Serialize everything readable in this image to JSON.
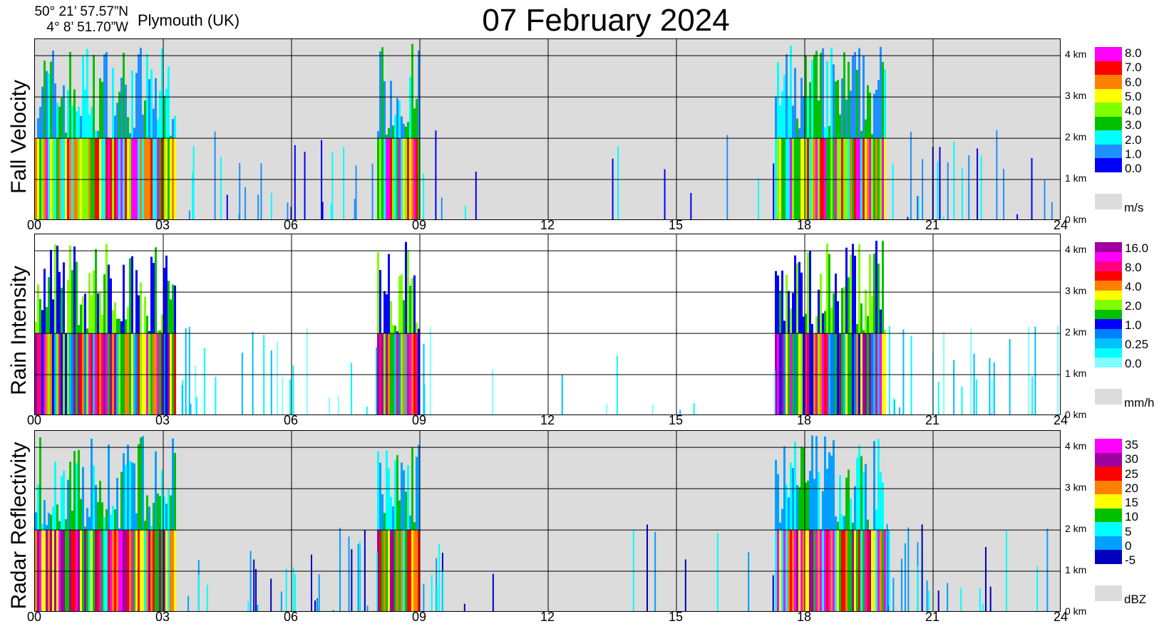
{
  "header": {
    "lat": "50° 21’ 57.57”N",
    "lon": "4°  8’ 51.70”W",
    "location": "Plymouth (UK)",
    "title": "07 February  2024"
  },
  "x_ticks": [
    "00",
    "03",
    "06",
    "09",
    "12",
    "15",
    "18",
    "21",
    "24"
  ],
  "height_ticks": [
    "4 km",
    "3 km",
    "2 km",
    "1 km",
    "0 km"
  ],
  "chart_data": [
    {
      "type": "heatmap",
      "title": "Fall Velocity",
      "x_range_hours": [
        0,
        24
      ],
      "y_range_km": [
        0,
        4.4
      ],
      "grid": true,
      "colorbar": {
        "unit": "m/s",
        "labels": [
          "8.0",
          "7.0",
          "6.0",
          "5.0",
          "4.0",
          "3.0",
          "2.0",
          "1.0",
          "0.0"
        ],
        "colors": [
          "#ff00ff",
          "#ff0000",
          "#ff8000",
          "#ffff00",
          "#80ff00",
          "#00c000",
          "#00ffff",
          "#1e90ff",
          "#0000ff"
        ]
      },
      "precip_periods_hours": [
        [
          0.0,
          3.3
        ],
        [
          8.0,
          9.0
        ],
        [
          17.3,
          19.9
        ]
      ],
      "background_color": "#dcdcdc"
    },
    {
      "type": "heatmap",
      "title": "Rain Intensity",
      "x_range_hours": [
        0,
        24
      ],
      "y_range_km": [
        0,
        4.4
      ],
      "grid": true,
      "colorbar": {
        "unit": "mm/h",
        "labels": [
          "16.0",
          "8.0",
          "4.0",
          "2.0",
          "1.0",
          "0.25",
          "0.0"
        ],
        "colors": [
          "#a000a0",
          "#ff00ff",
          "#ff0080",
          "#ff0000",
          "#ff8000",
          "#ffff00",
          "#80ff00",
          "#00c000",
          "#0000ff",
          "#0080ff",
          "#00c0ff",
          "#00ffff",
          "#80ffff"
        ]
      },
      "precip_periods_hours": [
        [
          0.0,
          3.3
        ],
        [
          8.0,
          9.0
        ],
        [
          17.3,
          19.9
        ]
      ],
      "background_color": "#ffffff"
    },
    {
      "type": "heatmap",
      "title": "Radar Reflectivity",
      "x_range_hours": [
        0,
        24
      ],
      "y_range_km": [
        0,
        4.4
      ],
      "grid": true,
      "colorbar": {
        "unit": "dBZ",
        "labels": [
          "35",
          "30",
          "25",
          "20",
          "15",
          "10",
          "5",
          "0",
          "-5"
        ],
        "colors": [
          "#ff00ff",
          "#a000a0",
          "#ff0000",
          "#ff8000",
          "#ffff00",
          "#00c000",
          "#00ffff",
          "#00a0ff",
          "#0000c0"
        ]
      },
      "precip_periods_hours": [
        [
          0.0,
          3.3
        ],
        [
          8.0,
          9.0
        ],
        [
          17.3,
          19.9
        ]
      ],
      "background_color": "#dcdcdc"
    }
  ]
}
